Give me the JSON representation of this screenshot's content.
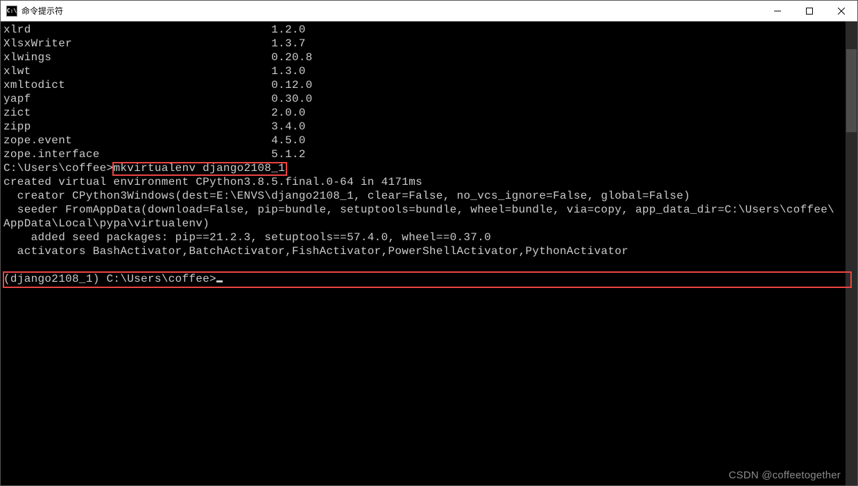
{
  "window": {
    "title": "命令提示符",
    "icon_text": "C:\\"
  },
  "packages": [
    {
      "name": "xlrd",
      "version": "1.2.0"
    },
    {
      "name": "XlsxWriter",
      "version": "1.3.7"
    },
    {
      "name": "xlwings",
      "version": "0.20.8"
    },
    {
      "name": "xlwt",
      "version": "1.3.0"
    },
    {
      "name": "xmltodict",
      "version": "0.12.0"
    },
    {
      "name": "yapf",
      "version": "0.30.0"
    },
    {
      "name": "zict",
      "version": "2.0.0"
    },
    {
      "name": "zipp",
      "version": "3.4.0"
    },
    {
      "name": "zope.event",
      "version": "4.5.0"
    },
    {
      "name": "zope.interface",
      "version": "5.1.2"
    }
  ],
  "prompt1_prefix": "C:\\Users\\coffee>",
  "prompt1_command": "mkvirtualenv django2108_1",
  "output_lines": [
    "created virtual environment CPython3.8.5.final.0-64 in 4171ms",
    "  creator CPython3Windows(dest=E:\\ENVS\\django2108_1, clear=False, no_vcs_ignore=False, global=False)",
    "  seeder FromAppData(download=False, pip=bundle, setuptools=bundle, wheel=bundle, via=copy, app_data_dir=C:\\Users\\coffee\\",
    "AppData\\Local\\pypa\\virtualenv)",
    "    added seed packages: pip==21.2.3, setuptools==57.4.0, wheel==0.37.0",
    "  activators BashActivator,BatchActivator,FishActivator,PowerShellActivator,PythonActivator"
  ],
  "prompt2": "(django2108_1) C:\\Users\\coffee>",
  "watermark": "CSDN @coffeetogether"
}
